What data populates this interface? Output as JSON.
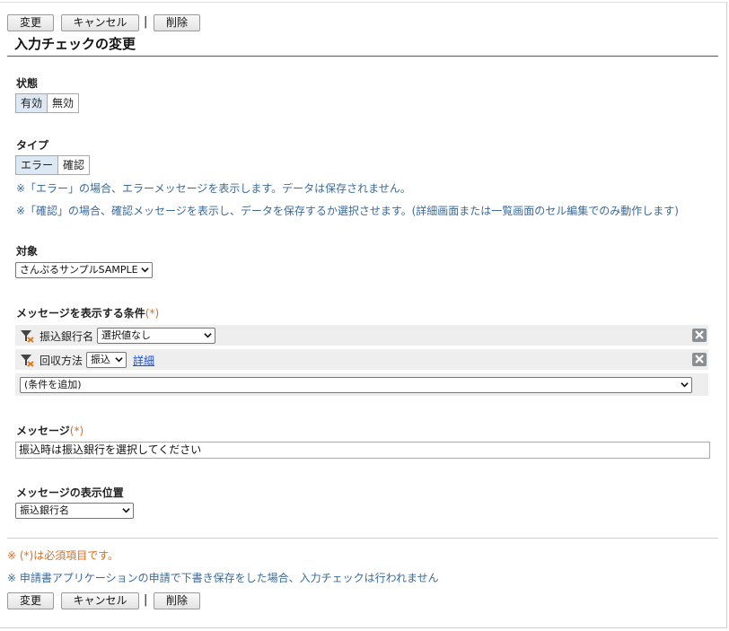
{
  "toolbar": {
    "change": "変更",
    "cancel": "キャンセル",
    "separator": "|",
    "delete": "削除"
  },
  "title": "入力チェックの変更",
  "status": {
    "label": "状態",
    "options": [
      "有効",
      "無効"
    ],
    "selected": "有効"
  },
  "type": {
    "label": "タイプ",
    "options": [
      "エラー",
      "確認"
    ],
    "selected": "エラー",
    "notes": [
      "※「エラー」の場合、エラーメッセージを表示します。データは保存されません。",
      "※「確認」の場合、確認メッセージを表示し、データを保存するか選択させます。(詳細画面または一覧画面のセル編集でのみ動作します)"
    ]
  },
  "target": {
    "label": "対象",
    "value": "さんぷるサンプルSAMPLE"
  },
  "conditions": {
    "label": "メッセージを表示する条件",
    "required_mark": "(*)",
    "rows": [
      {
        "field": "振込銀行名",
        "value": "選択値なし"
      },
      {
        "field": "回収方法",
        "value": "振込",
        "link": "詳細"
      }
    ],
    "add_placeholder": "(条件を追加)"
  },
  "message": {
    "label": "メッセージ",
    "required_mark": "(*)",
    "value": "振込時は振込銀行を選択してください"
  },
  "position": {
    "label": "メッセージの表示位置",
    "value": "振込銀行名"
  },
  "footer": {
    "required_note": "※ (*)は必須項目です。",
    "info_note": "※ 申請書アプリケーションの申請で下書き保存をした場合、入力チェックは行われません"
  },
  "colors": {
    "accent_orange": "#e06d1d",
    "note_blue": "#3b6b9a",
    "link_blue": "#1a4fd6",
    "selected_bg": "#dce8f3"
  },
  "icons": {
    "filter": "filter-remove-icon",
    "remove": "close-icon",
    "dropdown": "chevron-down-icon"
  }
}
